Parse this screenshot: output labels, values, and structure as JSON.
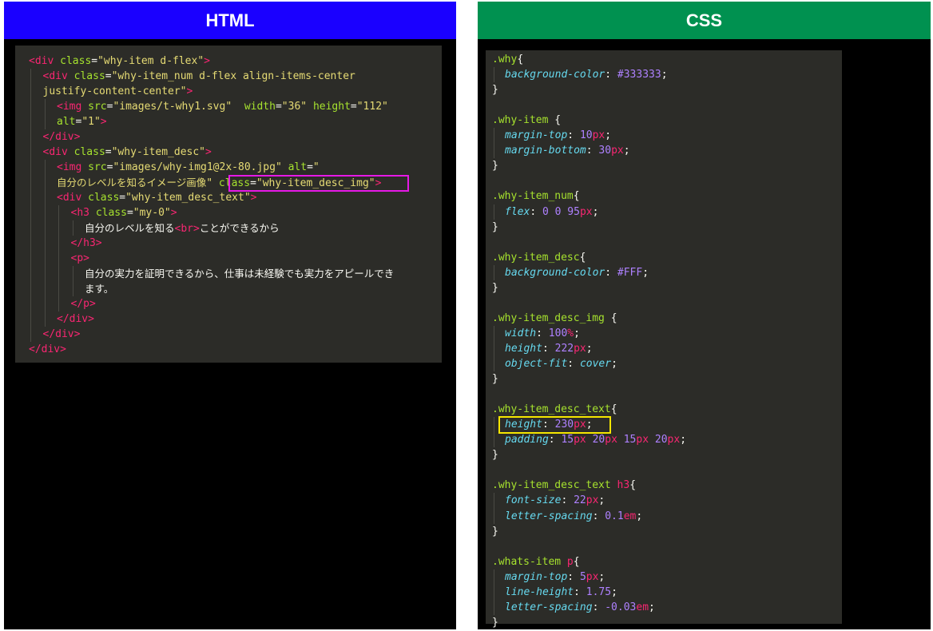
{
  "html_panel": {
    "title": "HTML",
    "header_color": "#1a00ff",
    "lines": [
      {
        "indent": 0,
        "parts": [
          [
            "tg",
            "<div "
          ],
          [
            "at",
            "class"
          ],
          [
            "pl",
            "="
          ],
          [
            "st",
            "\"why-item d-flex\""
          ],
          [
            "tg",
            ">"
          ]
        ]
      },
      {
        "indent": 1,
        "parts": [
          [
            "tg",
            "<div "
          ],
          [
            "at",
            "class"
          ],
          [
            "pl",
            "="
          ],
          [
            "st",
            "\"why-item_num d-flex align-items-center"
          ]
        ]
      },
      {
        "indent": 1,
        "parts": [
          [
            "st",
            "justify-content-center\""
          ],
          [
            "tg",
            ">"
          ]
        ]
      },
      {
        "indent": 2,
        "parts": [
          [
            "tg",
            "<img "
          ],
          [
            "at",
            "src"
          ],
          [
            "pl",
            "="
          ],
          [
            "st",
            "\"images/t-why1.svg\""
          ],
          [
            "pl",
            "  "
          ],
          [
            "at",
            "width"
          ],
          [
            "pl",
            "="
          ],
          [
            "st",
            "\"36\""
          ],
          [
            "pl",
            " "
          ],
          [
            "at",
            "height"
          ],
          [
            "pl",
            "="
          ],
          [
            "st",
            "\"112\""
          ]
        ]
      },
      {
        "indent": 2,
        "parts": [
          [
            "at",
            "alt"
          ],
          [
            "pl",
            "="
          ],
          [
            "st",
            "\"1\""
          ],
          [
            "tg",
            ">"
          ]
        ]
      },
      {
        "indent": 1,
        "parts": [
          [
            "tg",
            "</div>"
          ]
        ]
      },
      {
        "indent": 1,
        "parts": [
          [
            "tg",
            "<div "
          ],
          [
            "at",
            "class"
          ],
          [
            "pl",
            "="
          ],
          [
            "st",
            "\"why-item_desc\""
          ],
          [
            "tg",
            ">"
          ]
        ]
      },
      {
        "indent": 2,
        "parts": [
          [
            "tg",
            "<img "
          ],
          [
            "at",
            "src"
          ],
          [
            "pl",
            "="
          ],
          [
            "st",
            "\"images/why-img1@2x-80.jpg\""
          ],
          [
            "pl",
            " "
          ],
          [
            "at",
            "alt"
          ],
          [
            "pl",
            "="
          ],
          [
            "st",
            "\""
          ]
        ]
      },
      {
        "indent": 2,
        "parts": [
          [
            "st jp",
            "自分のレベルを知るイメージ画像"
          ],
          [
            "st",
            "\" "
          ],
          [
            "at",
            "class"
          ],
          [
            "pl",
            "="
          ],
          [
            "st",
            "\"why-item_desc_img\""
          ],
          [
            "tg",
            ">"
          ]
        ]
      },
      {
        "indent": 2,
        "parts": [
          [
            "tg",
            "<div "
          ],
          [
            "at",
            "class"
          ],
          [
            "pl",
            "="
          ],
          [
            "st",
            "\"why-item_desc_text\""
          ],
          [
            "tg",
            ">"
          ]
        ]
      },
      {
        "indent": 3,
        "parts": [
          [
            "tg",
            "<h3 "
          ],
          [
            "at",
            "class"
          ],
          [
            "pl",
            "="
          ],
          [
            "st",
            "\"my-0\""
          ],
          [
            "tg",
            ">"
          ]
        ]
      },
      {
        "indent": 4,
        "parts": [
          [
            "pl jp",
            "自分のレベルを知る"
          ],
          [
            "tg",
            "<br>"
          ],
          [
            "pl jp",
            "ことができるから"
          ]
        ]
      },
      {
        "indent": 3,
        "parts": [
          [
            "tg",
            "</h3>"
          ]
        ]
      },
      {
        "indent": 3,
        "parts": [
          [
            "tg",
            "<p>"
          ]
        ]
      },
      {
        "indent": 4,
        "parts": [
          [
            "pl jp",
            "自分の実力を証明できるから、仕事は未経験でも実力をアピールでき"
          ]
        ]
      },
      {
        "indent": 4,
        "parts": [
          [
            "pl jp",
            "ます。"
          ]
        ]
      },
      {
        "indent": 3,
        "parts": [
          [
            "tg",
            "</p>"
          ]
        ]
      },
      {
        "indent": 2,
        "parts": [
          [
            "tg",
            "</div>"
          ]
        ]
      },
      {
        "indent": 1,
        "parts": [
          [
            "tg",
            "</div>"
          ]
        ]
      },
      {
        "indent": 0,
        "parts": [
          [
            "tg",
            "</div>"
          ]
        ]
      }
    ]
  },
  "css_panel": {
    "title": "CSS",
    "header_color": "#009150",
    "lines": [
      {
        "indent": 0,
        "parts": [
          [
            "sel",
            ".why"
          ],
          [
            "pl",
            "{"
          ]
        ]
      },
      {
        "indent": 1,
        "parts": [
          [
            "pr",
            "background-color"
          ],
          [
            "pl",
            ": "
          ],
          [
            "nm",
            "#333333"
          ],
          [
            "pl",
            ";"
          ]
        ]
      },
      {
        "indent": 0,
        "parts": [
          [
            "pl",
            "}"
          ]
        ]
      },
      {
        "indent": 0,
        "parts": []
      },
      {
        "indent": 0,
        "parts": [
          [
            "sel",
            ".why-item"
          ],
          [
            "pl",
            " {"
          ]
        ]
      },
      {
        "indent": 1,
        "parts": [
          [
            "pr",
            "margin-top"
          ],
          [
            "pl",
            ": "
          ],
          [
            "nm",
            "10"
          ],
          [
            "un",
            "px"
          ],
          [
            "pl",
            ";"
          ]
        ]
      },
      {
        "indent": 1,
        "parts": [
          [
            "pr",
            "margin-bottom"
          ],
          [
            "pl",
            ": "
          ],
          [
            "nm",
            "30"
          ],
          [
            "un",
            "px"
          ],
          [
            "pl",
            ";"
          ]
        ]
      },
      {
        "indent": 0,
        "parts": [
          [
            "pl",
            "}"
          ]
        ]
      },
      {
        "indent": 0,
        "parts": []
      },
      {
        "indent": 0,
        "parts": [
          [
            "sel",
            ".why-item_num"
          ],
          [
            "pl",
            "{"
          ]
        ]
      },
      {
        "indent": 1,
        "parts": [
          [
            "pr",
            "flex"
          ],
          [
            "pl",
            ": "
          ],
          [
            "nm",
            "0 0 95"
          ],
          [
            "un",
            "px"
          ],
          [
            "pl",
            ";"
          ]
        ]
      },
      {
        "indent": 0,
        "parts": [
          [
            "pl",
            "}"
          ]
        ]
      },
      {
        "indent": 0,
        "parts": []
      },
      {
        "indent": 0,
        "parts": [
          [
            "sel",
            ".why-item_desc"
          ],
          [
            "pl",
            "{"
          ]
        ]
      },
      {
        "indent": 1,
        "parts": [
          [
            "pr",
            "background-color"
          ],
          [
            "pl",
            ": "
          ],
          [
            "nm",
            "#FFF"
          ],
          [
            "pl",
            ";"
          ]
        ]
      },
      {
        "indent": 0,
        "parts": [
          [
            "pl",
            "}"
          ]
        ]
      },
      {
        "indent": 0,
        "parts": []
      },
      {
        "indent": 0,
        "parts": [
          [
            "sel",
            ".why-item_desc_img"
          ],
          [
            "pl",
            " {"
          ]
        ]
      },
      {
        "indent": 1,
        "parts": [
          [
            "pr",
            "width"
          ],
          [
            "pl",
            ": "
          ],
          [
            "nm",
            "100"
          ],
          [
            "un",
            "%"
          ],
          [
            "pl",
            ";"
          ]
        ]
      },
      {
        "indent": 1,
        "parts": [
          [
            "pr",
            "height"
          ],
          [
            "pl",
            ": "
          ],
          [
            "nm",
            "222"
          ],
          [
            "un",
            "px"
          ],
          [
            "pl",
            ";"
          ]
        ]
      },
      {
        "indent": 1,
        "parts": [
          [
            "pr",
            "object-fit"
          ],
          [
            "pl",
            ": "
          ],
          [
            "pr",
            "cover"
          ],
          [
            "pl",
            ";"
          ]
        ]
      },
      {
        "indent": 0,
        "parts": [
          [
            "pl",
            "}"
          ]
        ]
      },
      {
        "indent": 0,
        "parts": []
      },
      {
        "indent": 0,
        "parts": [
          [
            "sel",
            ".why-item_desc_text"
          ],
          [
            "pl",
            "{"
          ]
        ]
      },
      {
        "indent": 1,
        "parts": [
          [
            "pr",
            "height"
          ],
          [
            "pl",
            ": "
          ],
          [
            "nm",
            "230"
          ],
          [
            "un",
            "px"
          ],
          [
            "pl",
            ";"
          ]
        ]
      },
      {
        "indent": 1,
        "parts": [
          [
            "pr",
            "padding"
          ],
          [
            "pl",
            ": "
          ],
          [
            "nm",
            "15"
          ],
          [
            "un",
            "px"
          ],
          [
            "pl",
            " "
          ],
          [
            "nm",
            "20"
          ],
          [
            "un",
            "px"
          ],
          [
            "pl",
            " "
          ],
          [
            "nm",
            "15"
          ],
          [
            "un",
            "px"
          ],
          [
            "pl",
            " "
          ],
          [
            "nm",
            "20"
          ],
          [
            "un",
            "px"
          ],
          [
            "pl",
            ";"
          ]
        ]
      },
      {
        "indent": 0,
        "parts": [
          [
            "pl",
            "}"
          ]
        ]
      },
      {
        "indent": 0,
        "parts": []
      },
      {
        "indent": 0,
        "parts": [
          [
            "sel",
            ".why-item_desc_text "
          ],
          [
            "tg",
            "h3"
          ],
          [
            "pl",
            "{"
          ]
        ]
      },
      {
        "indent": 1,
        "parts": [
          [
            "pr",
            "font-size"
          ],
          [
            "pl",
            ": "
          ],
          [
            "nm",
            "22"
          ],
          [
            "un",
            "px"
          ],
          [
            "pl",
            ";"
          ]
        ]
      },
      {
        "indent": 1,
        "parts": [
          [
            "pr",
            "letter-spacing"
          ],
          [
            "pl",
            ": "
          ],
          [
            "nm",
            "0.1"
          ],
          [
            "un",
            "em"
          ],
          [
            "pl",
            ";"
          ]
        ]
      },
      {
        "indent": 0,
        "parts": [
          [
            "pl",
            "}"
          ]
        ]
      },
      {
        "indent": 0,
        "parts": []
      },
      {
        "indent": 0,
        "parts": [
          [
            "sel",
            ".whats-item "
          ],
          [
            "tg",
            "p"
          ],
          [
            "pl",
            "{"
          ]
        ]
      },
      {
        "indent": 1,
        "parts": [
          [
            "pr",
            "margin-top"
          ],
          [
            "pl",
            ": "
          ],
          [
            "nm",
            "5"
          ],
          [
            "un",
            "px"
          ],
          [
            "pl",
            ";"
          ]
        ]
      },
      {
        "indent": 1,
        "parts": [
          [
            "pr",
            "line-height"
          ],
          [
            "pl",
            ": "
          ],
          [
            "nm",
            "1.75"
          ],
          [
            "pl",
            ";"
          ]
        ]
      },
      {
        "indent": 1,
        "parts": [
          [
            "pr",
            "letter-spacing"
          ],
          [
            "pl",
            ": "
          ],
          [
            "nm",
            "-0.03"
          ],
          [
            "un",
            "em"
          ],
          [
            "pl",
            ";"
          ]
        ]
      },
      {
        "indent": 0,
        "parts": [
          [
            "pl",
            "}"
          ]
        ]
      }
    ]
  },
  "highlights": {
    "magenta": "#e619e6",
    "yellow": "#f5e600"
  }
}
